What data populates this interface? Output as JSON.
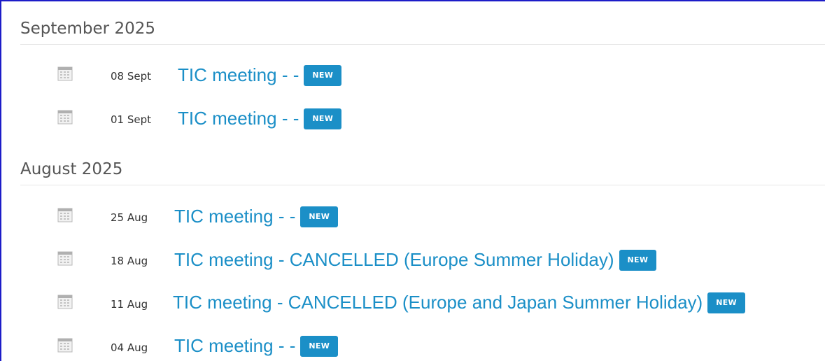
{
  "sections": [
    {
      "month": "September 2025",
      "events": [
        {
          "date": "08 Sept",
          "title": "TIC meeting - -",
          "badge": "NEW"
        },
        {
          "date": "01 Sept",
          "title": "TIC meeting - -",
          "badge": "NEW"
        }
      ]
    },
    {
      "month": "August 2025",
      "events": [
        {
          "date": "25 Aug",
          "title": "TIC meeting - -",
          "badge": "NEW"
        },
        {
          "date": "18 Aug",
          "title": "TIC meeting - CANCELLED (Europe Summer Holiday)",
          "badge": "NEW"
        },
        {
          "date": "11 Aug",
          "title": "TIC meeting - CANCELLED (Europe and Japan Summer Holiday)",
          "badge": "NEW"
        },
        {
          "date": "04 Aug",
          "title": "TIC meeting - -",
          "badge": "NEW"
        }
      ]
    }
  ],
  "colors": {
    "link": "#1b8fc7",
    "badge_bg": "#1b8fc7",
    "month_text": "#555555",
    "frame_border": "#1c1cc8"
  },
  "icons": {
    "event_icon": "calendar-icon"
  }
}
